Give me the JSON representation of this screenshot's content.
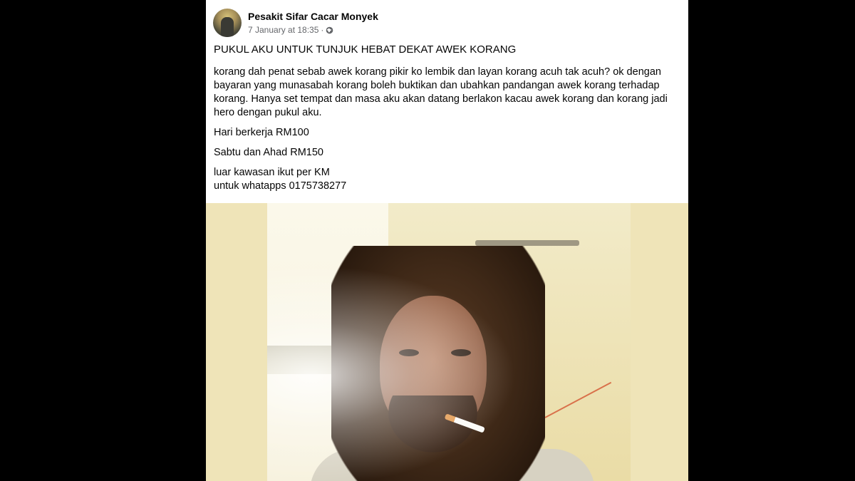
{
  "post": {
    "author": "Pesakit Sifar Cacar Monyek",
    "timestamp": "7 January at 18:35",
    "separator": "·",
    "privacy_icon": "globe-icon",
    "title": "PUKUL AKU UNTUK TUNJUK HEBAT DEKAT AWEK KORANG",
    "body": "korang dah penat sebab awek korang pikir ko lembik dan layan korang acuh tak acuh? ok dengan bayaran yang munasabah korang boleh buktikan dan ubahkan pandangan awek korang terhadap korang. Hanya set tempat dan masa aku akan datang berlakon kacau awek korang dan korang jadi hero dengan pukul aku.",
    "price_weekday": "Hari berkerja RM100",
    "price_weekend": "Sabtu dan Ahad RM150",
    "outside_area": "luar kawasan ikut per KM",
    "contact": "untuk whatapps 0175738277"
  },
  "colors": {
    "background": "#000000",
    "card": "#ffffff",
    "text": "#050505",
    "secondary_text": "#65676b"
  }
}
